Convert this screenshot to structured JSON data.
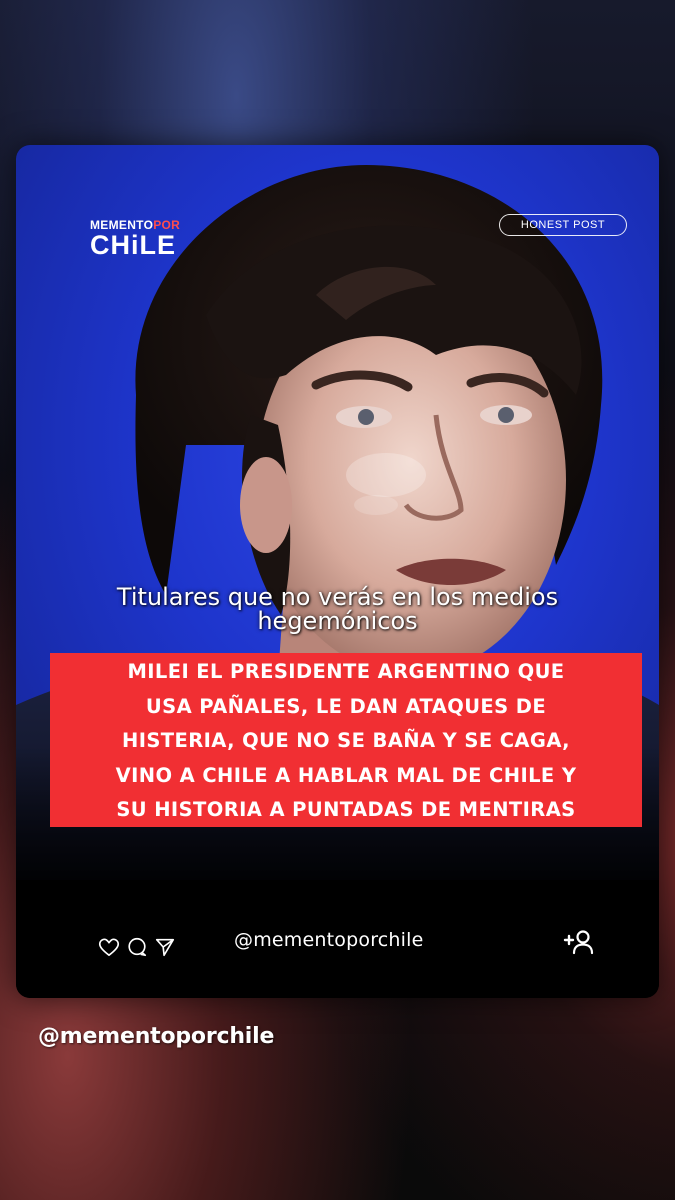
{
  "post": {
    "brand": {
      "top_word": "MEMENTO",
      "top_accent": "POR",
      "bottom_word": "CHiLE"
    },
    "badge": "HONEST POST",
    "subtitle_lines": [
      "Titulares que no verás en los medios",
      "hegemónicos"
    ],
    "headline_lines": [
      "MILEI EL PRESIDENTE ARGENTINO QUE",
      "USA PAÑALES, LE DAN ATAQUES DE",
      "HISTERIA, QUE NO SE BAÑA Y SE CAGA,",
      "VINO A CHILE A HABLAR MAL DE CHILE Y",
      "SU HISTORIA A PUNTADAS DE MENTIRAS"
    ],
    "actions": [
      "heart-icon",
      "comment-icon",
      "share-icon"
    ],
    "handle": "@mementoporchile",
    "follow_icon": "add-user-icon"
  },
  "story_caption": "@mementoporchile",
  "colors": {
    "headline_bg": "#f12f33",
    "photo_bg": "#2239d9",
    "logo_accent": "#ff4d4d",
    "footer_bg": "#000000"
  }
}
